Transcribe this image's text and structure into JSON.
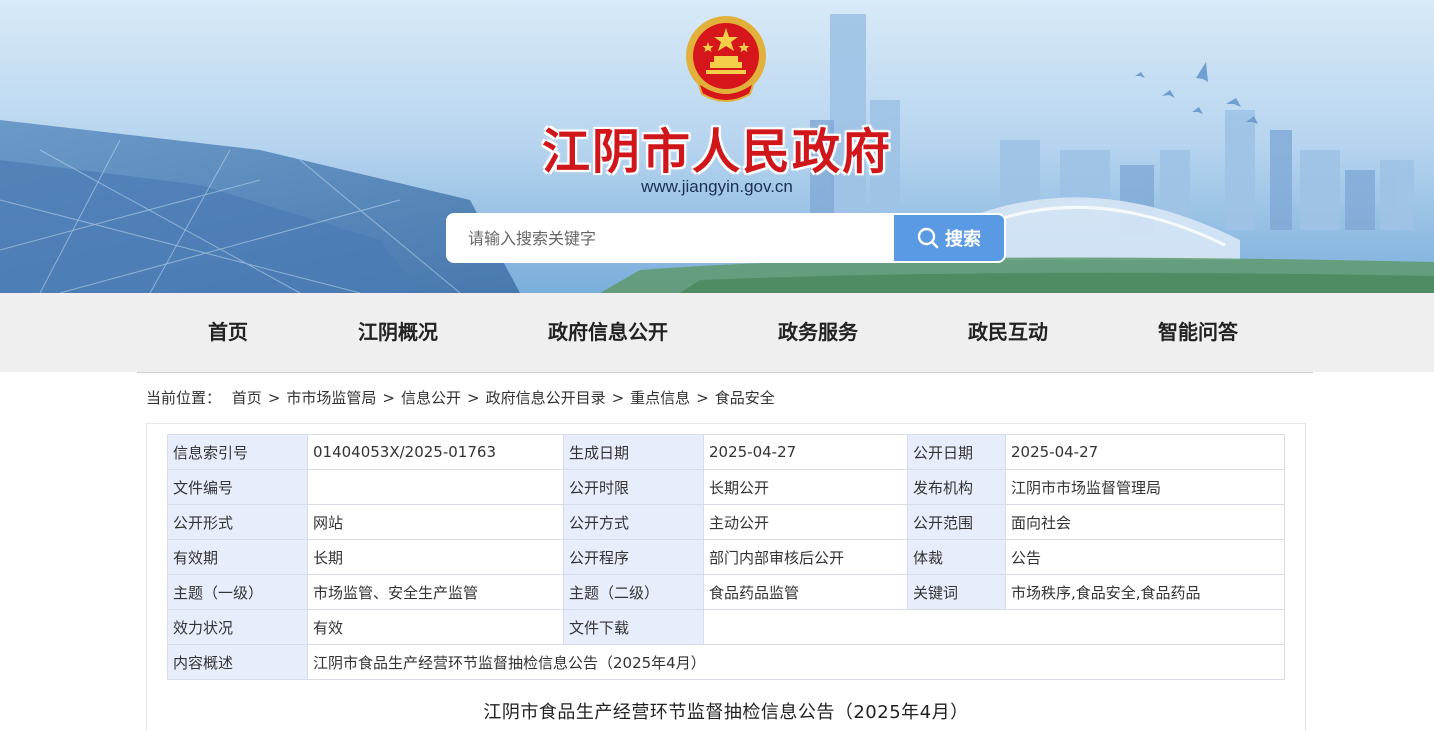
{
  "banner": {
    "site_title": "江阴市人民政府",
    "site_url": "www.jiangyin.gov.cn",
    "emblem_icon": "national-emblem-icon",
    "title_color": "#d0161b"
  },
  "search": {
    "placeholder": "请输入搜索关键字",
    "button_label": "搜索",
    "button_color": "#5a9ae4"
  },
  "nav": {
    "items": [
      "首页",
      "江阴概况",
      "政府信息公开",
      "政务服务",
      "政民互动",
      "智能问答"
    ]
  },
  "breadcrumb": {
    "prefix": "当前位置：",
    "items": [
      "首页",
      "市市场监管局",
      "信息公开",
      "政府信息公开目录",
      "重点信息",
      "食品安全"
    ],
    "separator": ">"
  },
  "meta_table": {
    "label_bg": "#e8edfc",
    "rows": [
      [
        {
          "label": "信息索引号",
          "value": "01404053X/2025-01763"
        },
        {
          "label": "生成日期",
          "value": "2025-04-27"
        },
        {
          "label": "公开日期",
          "value": "2025-04-27"
        }
      ],
      [
        {
          "label": "文件编号",
          "value": ""
        },
        {
          "label": "公开时限",
          "value": "长期公开"
        },
        {
          "label": "发布机构",
          "value": "江阴市市场监督管理局"
        }
      ],
      [
        {
          "label": "公开形式",
          "value": "网站"
        },
        {
          "label": "公开方式",
          "value": "主动公开"
        },
        {
          "label": "公开范围",
          "value": "面向社会"
        }
      ],
      [
        {
          "label": "有效期",
          "value": "长期"
        },
        {
          "label": "公开程序",
          "value": "部门内部审核后公开"
        },
        {
          "label": "体裁",
          "value": "公告"
        }
      ],
      [
        {
          "label": "主题（一级）",
          "value": "市场监管、安全生产监管"
        },
        {
          "label": "主题（二级）",
          "value": "食品药品监管"
        },
        {
          "label": "关键词",
          "value": "市场秩序,食品安全,食品药品"
        }
      ]
    ],
    "status_row": {
      "label": "效力状况",
      "value": "有效",
      "download_label": "文件下载",
      "download_value": ""
    },
    "summary_row": {
      "label": "内容概述",
      "value": "江阴市食品生产经营环节监督抽检信息公告（2025年4月）"
    }
  },
  "article": {
    "title": "江阴市食品生产经营环节监督抽检信息公告（2025年4月）"
  }
}
